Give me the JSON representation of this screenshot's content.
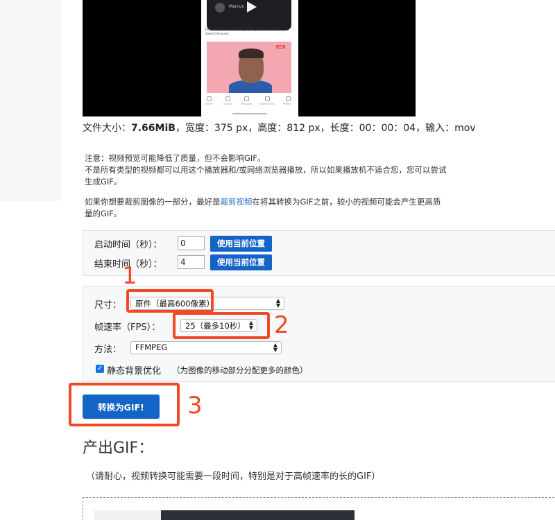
{
  "video_preview": {
    "post_name": "Marcus",
    "post_caption": "Instant Tweak: The Right Way To Start A Sh",
    "post_sub": "Swett Florissey",
    "live_badge": "LIVE",
    "tabs": [
      "Home",
      "Explore",
      "Messages",
      "Notifications",
      "Profile"
    ]
  },
  "file_info": {
    "size_label": "文件大小：",
    "size_value": "7.66MiB",
    "rest": "，宽度：375 px，高度：812 px，长度：00：00：04，输入：mov"
  },
  "notes": {
    "line1": "注意：视频预览可能降低了质量，但不会影响GIF。",
    "line2": "不是所有类型的视频都可以用这个播放器和/或网络浏览器播放，所以如果播放机不适合您，您可以尝试生成GIF。",
    "para2_before": "如果你想要裁剪图像的一部分，最好是",
    "para2_link": "裁剪视频",
    "para2_after": "在将其转换为GIF之前，较小的视频可能会产生更高质量的GIF。"
  },
  "time_settings": {
    "start_label": "启动时间（秒）：",
    "start_value": "0",
    "end_label": "结束时间（秒）：",
    "end_value": "4",
    "use_position_label": "使用当前位置"
  },
  "options": {
    "size_label": "尺寸：",
    "size_value": "原件（最高600像素）",
    "fps_label": "帧速率（FPS）：",
    "fps_value": "25（最多10秒）",
    "method_label": "方法：",
    "method_value": "FFMPEG",
    "static_bg_label": "静态背景优化",
    "static_bg_desc": "（为图像的移动部分分配更多的颜色）",
    "static_bg_checked": true
  },
  "convert_button": "转换为GIF!",
  "output": {
    "title": "产出GIF：",
    "note": "（请耐心，视频转换可能需要一段时间，特别是对于高帧速率的长的GIF）"
  },
  "annotations": [
    "1",
    "2",
    "3"
  ],
  "colors": {
    "accent_blue": "#1463c6",
    "annotation_red": "#ef4a25",
    "link_blue": "#1d6ec9"
  }
}
